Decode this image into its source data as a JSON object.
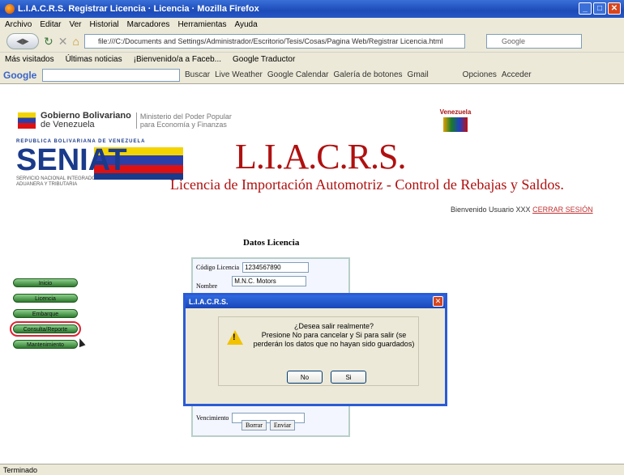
{
  "window": {
    "title": "L.I.A.C.R.S. Registrar Licencia · Licencia · Mozilla Firefox"
  },
  "menu": [
    "Archivo",
    "Editar",
    "Ver",
    "Historial",
    "Marcadores",
    "Herramientas",
    "Ayuda"
  ],
  "nav": {
    "url": "file:///C:/Documents and Settings/Administrador/Escritorio/Tesis/Cosas/Pagina Web/Registrar Licencia.html",
    "search_placeholder": "Google"
  },
  "bookmarks": [
    "Más visitados",
    "Últimas noticias",
    "¡Bienvenido/a a Faceb...",
    "Google Traductor"
  ],
  "gbar": {
    "logo": "Google",
    "tools": [
      "Buscar",
      "Live Weather",
      "Google Calendar",
      "Galería de botones",
      "Gmail",
      "Opciones",
      "Acceder"
    ]
  },
  "header": {
    "gob_line1": "Gobierno Bolivariano",
    "gob_line2": "de Venezuela",
    "min_line1": "Ministerio del Poder Popular",
    "min_line2": "para Economía y Finanzas",
    "ven_label": "Venezuela",
    "seniat_rep": "REPUBLICA BOLIVARIANA DE VENEZUELA",
    "seniat_logo": "SENIAT",
    "seniat_sub": "SERVICIO NACIONAL INTEGRADO DE ADMINISTRACIÓN ADUANERA Y TRIBUTARIA",
    "app_title": "L.I.A.C.R.S.",
    "app_subtitle": "Licencia de Importación Automotriz - Control de Rebajas y Saldos."
  },
  "welcome": {
    "text": "Bienvenido Usuario XXX",
    "logout": "CERRAR SESIÓN"
  },
  "sidenav": [
    "Inicio",
    "Licencia",
    "Embarque",
    "Consulta/Reporte",
    "Mantenimiento"
  ],
  "form": {
    "title": "Datos Licencia",
    "code_label": "Código Licencia",
    "code_value": "1234567890",
    "name_label": "Nombre",
    "name_value": "M.N.C. Motors",
    "expiry_label": "Vencimiento",
    "clear_button": "Borrar",
    "send_button": "Enviar"
  },
  "dialog": {
    "title": "L.I.A.C.R.S.",
    "line1": "¿Desea salir realmente?",
    "line2": "Presione No para cancelar y Si para salir (se",
    "line3": "perderán los datos que no hayan sido guardados)",
    "no_button": "No",
    "yes_button": "Si"
  },
  "status": "Terminado",
  "colors": {
    "titlebar": "#2557c6",
    "brand_red": "#b01010",
    "nav_green": "#2f7a2f"
  }
}
